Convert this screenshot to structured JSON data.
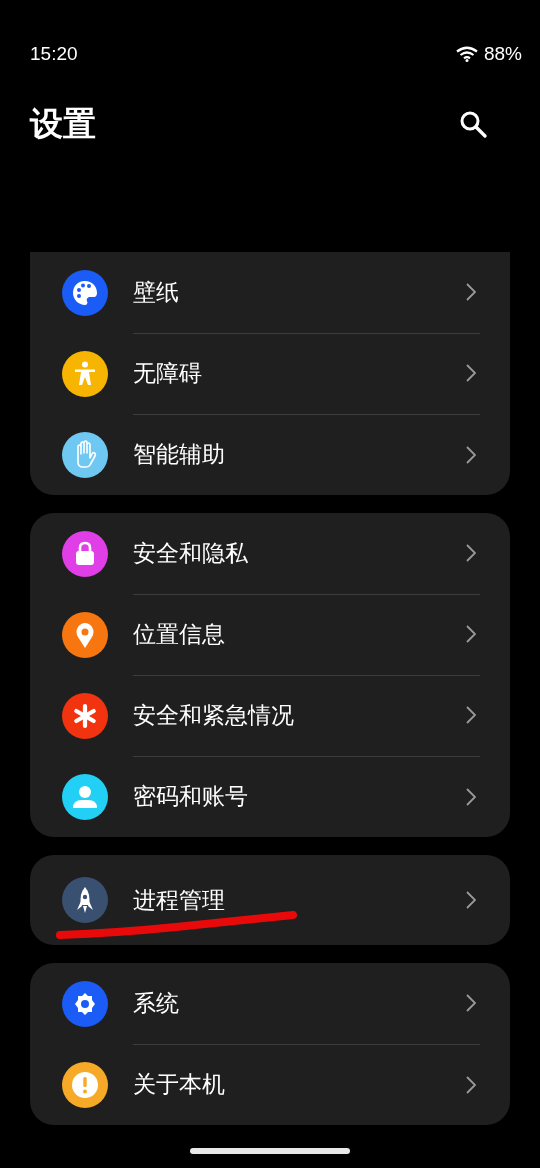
{
  "status_bar": {
    "time": "15:20",
    "battery": "88%"
  },
  "header": {
    "title": "设置"
  },
  "groups": [
    {
      "cut_top": true,
      "items": [
        {
          "label": "壁纸",
          "kind": "palette",
          "color": "#1a5cf5",
          "underlined": false
        },
        {
          "label": "无障碍",
          "kind": "accessibility",
          "color": "#f7b400",
          "underlined": false
        },
        {
          "label": "智能辅助",
          "kind": "hand",
          "color": "#6ec8f2",
          "underlined": false
        }
      ]
    },
    {
      "cut_top": false,
      "items": [
        {
          "label": "安全和隐私",
          "kind": "lock",
          "color": "#e03ee6",
          "underlined": false
        },
        {
          "label": "位置信息",
          "kind": "pin",
          "color": "#f7760f",
          "underlined": false
        },
        {
          "label": "安全和紧急情况",
          "kind": "asterisk",
          "color": "#f2330f",
          "underlined": false
        },
        {
          "label": "密码和账号",
          "kind": "person",
          "color": "#22d0f5",
          "underlined": false
        }
      ]
    },
    {
      "cut_top": false,
      "items": [
        {
          "label": "进程管理",
          "kind": "rocket",
          "color": "#3a5070",
          "underlined": true
        }
      ]
    },
    {
      "cut_top": false,
      "items": [
        {
          "label": "系统",
          "kind": "gear",
          "color": "#1a5cf5",
          "underlined": false
        },
        {
          "label": "关于本机",
          "kind": "info",
          "color": "#f7a928",
          "underlined": false
        }
      ]
    }
  ]
}
